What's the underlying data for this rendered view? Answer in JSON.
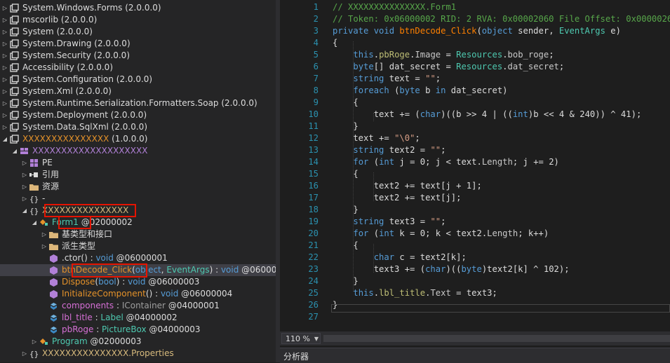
{
  "tree": [
    {
      "arrow": "▷",
      "icon": "asm",
      "parts": [
        {
          "c": "gray",
          "t": "System.Windows.Forms (2.0.0.0)"
        }
      ]
    },
    {
      "arrow": "▷",
      "icon": "asm",
      "parts": [
        {
          "c": "gray",
          "t": "mscorlib (2.0.0.0)"
        }
      ]
    },
    {
      "arrow": "▷",
      "icon": "asm",
      "parts": [
        {
          "c": "gray",
          "t": "System (2.0.0.0)"
        }
      ]
    },
    {
      "arrow": "▷",
      "icon": "asm",
      "parts": [
        {
          "c": "gray",
          "t": "System.Drawing (2.0.0.0)"
        }
      ]
    },
    {
      "arrow": "▷",
      "icon": "asm",
      "parts": [
        {
          "c": "gray",
          "t": "System.Security (2.0.0.0)"
        }
      ]
    },
    {
      "arrow": "▷",
      "icon": "asm",
      "parts": [
        {
          "c": "gray",
          "t": "Accessibility (2.0.0.0)"
        }
      ]
    },
    {
      "arrow": "▷",
      "icon": "asm",
      "parts": [
        {
          "c": "gray",
          "t": "System.Configuration (2.0.0.0)"
        }
      ]
    },
    {
      "arrow": "▷",
      "icon": "asm",
      "parts": [
        {
          "c": "gray",
          "t": "System.Xml (2.0.0.0)"
        }
      ]
    },
    {
      "arrow": "▷",
      "icon": "asm",
      "parts": [
        {
          "c": "gray",
          "t": "System.Runtime.Serialization.Formatters.Soap (2.0.0.0)"
        }
      ]
    },
    {
      "arrow": "▷",
      "icon": "asm",
      "parts": [
        {
          "c": "gray",
          "t": "System.Deployment (2.0.0.0)"
        }
      ]
    },
    {
      "arrow": "▷",
      "icon": "asm",
      "parts": [
        {
          "c": "gray",
          "t": "System.Data.SqlXml (2.0.0.0)"
        }
      ]
    },
    {
      "arrow": "◢",
      "icon": "asm",
      "parts": [
        {
          "c": "orange",
          "t": "XXXXXXXXXXXXXXX"
        },
        {
          "c": "gray",
          "t": " (1.0.0.0)"
        }
      ]
    },
    {
      "arrow": "◢",
      "icon": "module",
      "parts": [
        {
          "c": "purple",
          "t": "XXXXXXXXXXXXXXXXXXXX"
        }
      ]
    },
    {
      "arrow": "▷",
      "icon": "pe",
      "parts": [
        {
          "c": "gray",
          "t": "PE"
        }
      ]
    },
    {
      "arrow": "▷",
      "icon": "ref",
      "parts": [
        {
          "c": "gray",
          "t": "引用"
        }
      ]
    },
    {
      "arrow": "▷",
      "icon": "folder",
      "parts": [
        {
          "c": "gray",
          "t": "资源"
        }
      ]
    },
    {
      "arrow": "▷",
      "icon": "ns",
      "parts": [
        {
          "c": "gray",
          "t": "-"
        }
      ]
    },
    {
      "arrow": "◢",
      "icon": "ns",
      "parts": [
        {
          "c": "yellow",
          "t": "XXXXXXXXXXXXXXX"
        }
      ]
    },
    {
      "arrow": "◢",
      "icon": "class",
      "parts": [
        {
          "c": "teal",
          "t": "Form1"
        },
        {
          "c": "gray",
          "t": " @02000002"
        }
      ]
    },
    {
      "arrow": "▷",
      "icon": "folder",
      "parts": [
        {
          "c": "gray",
          "t": "基类型和接口"
        }
      ]
    },
    {
      "arrow": "▷",
      "icon": "folder",
      "parts": [
        {
          "c": "gray",
          "t": "派生类型"
        }
      ]
    },
    {
      "arrow": "",
      "icon": "method",
      "parts": [
        {
          "c": "gray",
          "t": ".ctor() : "
        },
        {
          "c": "blue",
          "t": "void"
        },
        {
          "c": "gray",
          "t": " @06000001"
        }
      ]
    },
    {
      "arrow": "",
      "icon": "method",
      "sel": true,
      "parts": [
        {
          "c": "orange",
          "t": "btnDecode_Click"
        },
        {
          "c": "gray",
          "t": "("
        },
        {
          "c": "blue",
          "t": "object"
        },
        {
          "c": "gray",
          "t": ", "
        },
        {
          "c": "teal",
          "t": "EventArgs"
        },
        {
          "c": "gray",
          "t": ") : "
        },
        {
          "c": "blue",
          "t": "void"
        },
        {
          "c": "gray",
          "t": " @06000002"
        }
      ]
    },
    {
      "arrow": "",
      "icon": "method",
      "parts": [
        {
          "c": "orange",
          "t": "Dispose"
        },
        {
          "c": "gray",
          "t": "("
        },
        {
          "c": "blue",
          "t": "bool"
        },
        {
          "c": "gray",
          "t": ") : "
        },
        {
          "c": "blue",
          "t": "void"
        },
        {
          "c": "gray",
          "t": " @06000003"
        }
      ]
    },
    {
      "arrow": "",
      "icon": "method",
      "parts": [
        {
          "c": "orange",
          "t": "InitializeComponent"
        },
        {
          "c": "gray",
          "t": "() : "
        },
        {
          "c": "blue",
          "t": "void"
        },
        {
          "c": "gray",
          "t": " @06000004"
        }
      ]
    },
    {
      "arrow": "",
      "icon": "field",
      "parts": [
        {
          "c": "mag",
          "t": "components"
        },
        {
          "c": "gray",
          "t": " : "
        },
        {
          "c": "dim",
          "t": "IContainer"
        },
        {
          "c": "gray",
          "t": " @04000001"
        }
      ]
    },
    {
      "arrow": "",
      "icon": "field",
      "parts": [
        {
          "c": "mag",
          "t": "lbl_title"
        },
        {
          "c": "gray",
          "t": " : "
        },
        {
          "c": "teal",
          "t": "Label"
        },
        {
          "c": "gray",
          "t": " @04000002"
        }
      ]
    },
    {
      "arrow": "",
      "icon": "field",
      "parts": [
        {
          "c": "mag",
          "t": "pbRoge"
        },
        {
          "c": "gray",
          "t": " : "
        },
        {
          "c": "teal",
          "t": "PictureBox"
        },
        {
          "c": "gray",
          "t": " @04000003"
        }
      ]
    },
    {
      "arrow": "▷",
      "icon": "class",
      "parts": [
        {
          "c": "teal",
          "t": "Program"
        },
        {
          "c": "gray",
          "t": " @02000003"
        }
      ]
    },
    {
      "arrow": "▷",
      "icon": "ns",
      "parts": [
        {
          "c": "yellow",
          "t": "XXXXXXXXXXXXXXX.Properties"
        }
      ]
    }
  ],
  "code": [
    {
      "n": "1",
      "toks": [
        [
          "cm",
          "// XXXXXXXXXXXXXXX.Form1"
        ]
      ]
    },
    {
      "n": "2",
      "toks": [
        [
          "cm",
          "// Token: 0x06000002 RID: 2 RVA: 0x00002060 File Offset: 0x00000260"
        ]
      ]
    },
    {
      "n": "3",
      "toks": [
        [
          "k",
          "private "
        ],
        [
          "k",
          "void "
        ],
        [
          "fn",
          "btnDecode_Click"
        ],
        [
          "",
          "("
        ],
        [
          "k",
          "object "
        ],
        [
          "",
          "sender, "
        ],
        [
          "t",
          "EventArgs "
        ],
        [
          "",
          "e)"
        ]
      ]
    },
    {
      "n": "4",
      "toks": [
        [
          "",
          "{"
        ]
      ]
    },
    {
      "n": "5",
      "toks": [
        [
          "",
          "    "
        ],
        [
          "k",
          "this"
        ],
        [
          "",
          "."
        ],
        [
          "fl",
          "pbRoge"
        ],
        [
          "",
          "."
        ],
        [
          "pr",
          "Image"
        ],
        [
          "",
          " = "
        ],
        [
          "t",
          "Resources"
        ],
        [
          "",
          "."
        ],
        [
          "pr",
          "bob_roge"
        ],
        [
          "",
          ";"
        ]
      ]
    },
    {
      "n": "6",
      "toks": [
        [
          "",
          "    "
        ],
        [
          "k",
          "byte"
        ],
        [
          "",
          "[] dat_secret = "
        ],
        [
          "t",
          "Resources"
        ],
        [
          "",
          "."
        ],
        [
          "pr",
          "dat_secret"
        ],
        [
          "",
          ";"
        ]
      ]
    },
    {
      "n": "7",
      "toks": [
        [
          "",
          "    "
        ],
        [
          "k",
          "string "
        ],
        [
          "",
          "text = "
        ],
        [
          "s",
          "\"\""
        ],
        [
          "",
          ";"
        ]
      ]
    },
    {
      "n": "8",
      "toks": [
        [
          "",
          "    "
        ],
        [
          "k",
          "foreach "
        ],
        [
          "",
          "("
        ],
        [
          "k",
          "byte "
        ],
        [
          "",
          "b "
        ],
        [
          "k",
          "in "
        ],
        [
          "",
          "dat_secret)"
        ]
      ]
    },
    {
      "n": "9",
      "toks": [
        [
          "",
          "    {"
        ]
      ]
    },
    {
      "n": "10",
      "toks": [
        [
          "",
          "        text += ("
        ],
        [
          "k",
          "char"
        ],
        [
          "",
          ")((b >> 4 | (("
        ],
        [
          "k",
          "int"
        ],
        [
          "",
          ")b << 4 & 240)) ^ 41);"
        ]
      ]
    },
    {
      "n": "11",
      "toks": [
        [
          "",
          "    }"
        ]
      ]
    },
    {
      "n": "12",
      "toks": [
        [
          "",
          "    text += "
        ],
        [
          "s",
          "\"\\0\""
        ],
        [
          "",
          ";"
        ]
      ]
    },
    {
      "n": "13",
      "toks": [
        [
          "",
          "    "
        ],
        [
          "k",
          "string "
        ],
        [
          "",
          "text2 = "
        ],
        [
          "s",
          "\"\""
        ],
        [
          "",
          ";"
        ]
      ]
    },
    {
      "n": "14",
      "toks": [
        [
          "",
          "    "
        ],
        [
          "k",
          "for "
        ],
        [
          "",
          "("
        ],
        [
          "k",
          "int "
        ],
        [
          "",
          "j = 0; j < text."
        ],
        [
          "pr",
          "Length"
        ],
        [
          "",
          "; j += 2)"
        ]
      ]
    },
    {
      "n": "15",
      "toks": [
        [
          "",
          "    {"
        ]
      ]
    },
    {
      "n": "16",
      "toks": [
        [
          "",
          "        text2 += text[j + 1];"
        ]
      ]
    },
    {
      "n": "17",
      "toks": [
        [
          "",
          "        text2 += text[j];"
        ]
      ]
    },
    {
      "n": "18",
      "toks": [
        [
          "",
          "    }"
        ]
      ]
    },
    {
      "n": "19",
      "toks": [
        [
          "",
          "    "
        ],
        [
          "k",
          "string "
        ],
        [
          "",
          "text3 = "
        ],
        [
          "s",
          "\"\""
        ],
        [
          "",
          ";"
        ]
      ]
    },
    {
      "n": "20",
      "toks": [
        [
          "",
          "    "
        ],
        [
          "k",
          "for "
        ],
        [
          "",
          "("
        ],
        [
          "k",
          "int "
        ],
        [
          "",
          "k = 0; k < text2."
        ],
        [
          "pr",
          "Length"
        ],
        [
          "",
          "; k++)"
        ]
      ]
    },
    {
      "n": "21",
      "toks": [
        [
          "",
          "    {"
        ]
      ]
    },
    {
      "n": "22",
      "toks": [
        [
          "",
          "        "
        ],
        [
          "k",
          "char "
        ],
        [
          "",
          "c = text2[k];"
        ]
      ]
    },
    {
      "n": "23",
      "toks": [
        [
          "",
          "        text3 += ("
        ],
        [
          "k",
          "char"
        ],
        [
          "",
          ")(("
        ],
        [
          "k",
          "byte"
        ],
        [
          "",
          ")text2[k] ^ 102);"
        ]
      ]
    },
    {
      "n": "24",
      "toks": [
        [
          "",
          "    }"
        ]
      ]
    },
    {
      "n": "25",
      "toks": [
        [
          "",
          "    "
        ],
        [
          "k",
          "this"
        ],
        [
          "",
          "."
        ],
        [
          "fl",
          "lbl_title"
        ],
        [
          "",
          "."
        ],
        [
          "pr",
          "Text"
        ],
        [
          "",
          " = text3;"
        ]
      ]
    },
    {
      "n": "26",
      "toks": [
        [
          "",
          "}"
        ]
      ]
    },
    {
      "n": "27",
      "toks": []
    }
  ],
  "status": {
    "zoom": "110 %"
  },
  "bottom_tab": "分析器"
}
